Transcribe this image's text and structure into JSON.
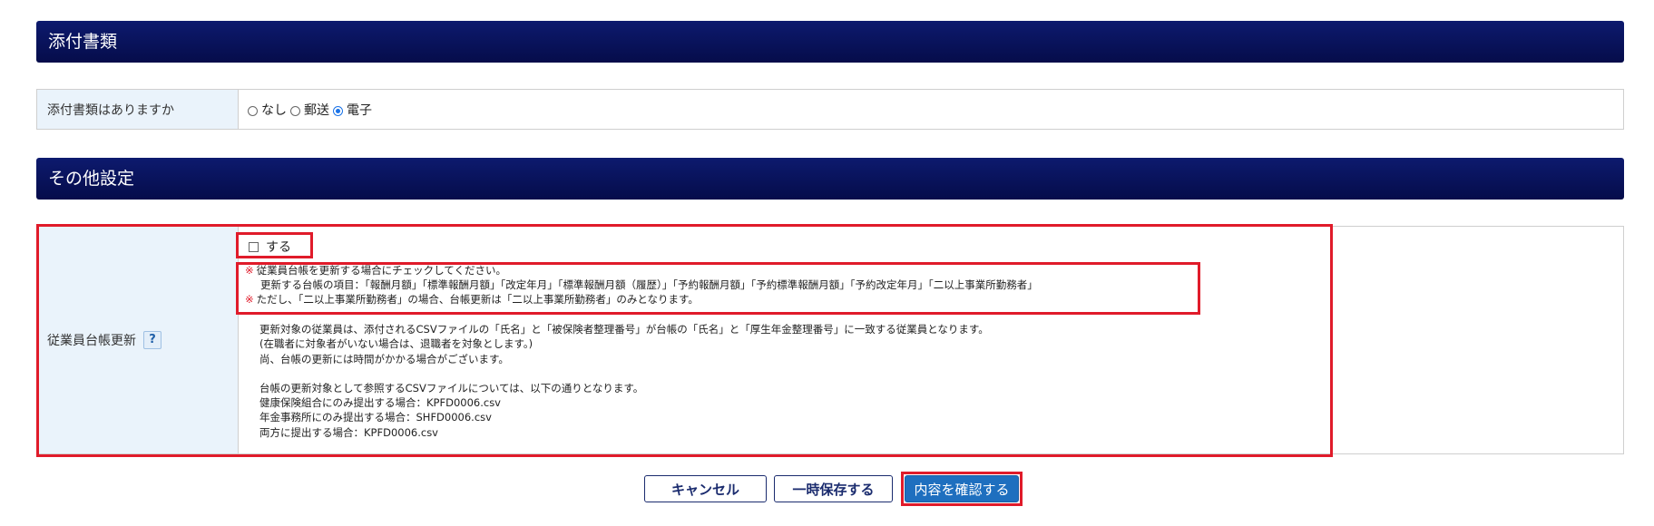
{
  "section_attach": {
    "title": "添付書類"
  },
  "attach_row": {
    "label": "添付書類はありますか",
    "options": [
      {
        "label": "なし",
        "selected": false
      },
      {
        "label": "郵送",
        "selected": false
      },
      {
        "label": "電子",
        "selected": true
      }
    ]
  },
  "section_other": {
    "title": "その他設定"
  },
  "update_row": {
    "label": "従業員台帳更新",
    "help": "?",
    "checkbox_label": "する",
    "notes": {
      "mark": "※",
      "line1": "従業員台帳を更新する場合にチェックしてください。",
      "line2": "更新する台帳の項目：「報酬月額」「標準報酬月額」「改定年月」「標準報酬月額（履歴）」「予約報酬月額」「予約標準報酬月額」「予約改定年月」「二以上事業所勤務者」",
      "line3": "ただし、「二以上事業所勤務者」の場合、台帳更新は「二以上事業所勤務者」のみとなります。"
    },
    "description": {
      "line1": "更新対象の従業員は、添付されるCSVファイルの「氏名」と「被保険者整理番号」が台帳の「氏名」と「厚生年金整理番号」に一致する従業員となります。",
      "line2": "(在職者に対象者がいない場合は、退職者を対象とします。)",
      "line3": "尚、台帳の更新には時間がかかる場合がございます。",
      "line4": "台帳の更新対象として参照するCSVファイルについては、以下の通りとなります。",
      "line5": "健康保険組合にのみ提出する場合：KPFD0006.csv",
      "line6": "年金事務所にのみ提出する場合：SHFD0006.csv",
      "line7": "両方に提出する場合：KPFD0006.csv"
    }
  },
  "buttons": {
    "cancel": "キャンセル",
    "save": "一時保存する",
    "confirm": "内容を確認する"
  },
  "colors": {
    "header_bg": "#0a1560",
    "label_bg": "#eaf3fb",
    "highlight": "#e01b2a",
    "primary_button": "#1e6fbf"
  }
}
